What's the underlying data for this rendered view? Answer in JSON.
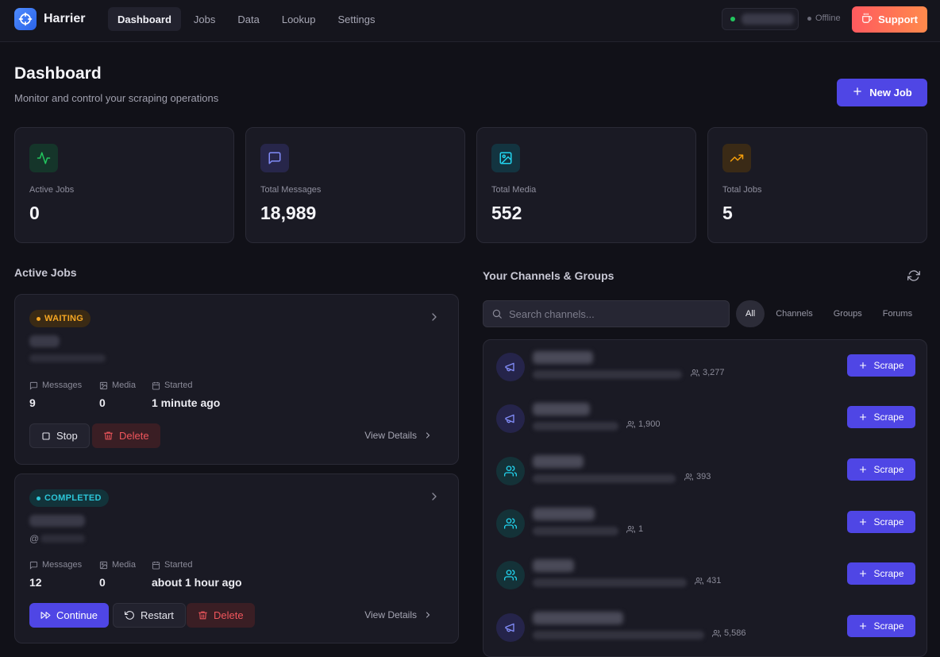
{
  "brand": {
    "name": "Harrier"
  },
  "nav": [
    {
      "label": "Dashboard",
      "active": true
    },
    {
      "label": "Jobs"
    },
    {
      "label": "Data"
    },
    {
      "label": "Lookup"
    },
    {
      "label": "Settings"
    }
  ],
  "status": {
    "connection": "Offline"
  },
  "support": {
    "label": "Support"
  },
  "page": {
    "title": "Dashboard",
    "subtitle": "Monitor and control your scraping operations",
    "new_job_label": "New Job"
  },
  "stats": [
    {
      "label": "Active Jobs",
      "value": "0",
      "icon": "activity-icon",
      "color": "#22c55e"
    },
    {
      "label": "Total Messages",
      "value": "18,989",
      "icon": "message-square-icon",
      "color": "#818cf8"
    },
    {
      "label": "Total Media",
      "value": "552",
      "icon": "image-icon",
      "color": "#22d3ee"
    },
    {
      "label": "Total Jobs",
      "value": "5",
      "icon": "trending-up-icon",
      "color": "#f59e0b"
    }
  ],
  "active_jobs": {
    "title": "Active Jobs",
    "labels": {
      "messages": "Messages",
      "media": "Media",
      "started": "Started",
      "view_details": "View Details"
    },
    "jobs": [
      {
        "status": "WAITING",
        "handle": "",
        "messages": "9",
        "media": "0",
        "started": "1 minute ago",
        "actions": [
          "Stop",
          "Delete"
        ]
      },
      {
        "status": "COMPLETED",
        "handle": "@",
        "messages": "12",
        "media": "0",
        "started": "about 1 hour ago",
        "actions": [
          "Continue",
          "Restart",
          "Delete"
        ]
      }
    ]
  },
  "channels": {
    "title": "Your Channels & Groups",
    "search_placeholder": "Search channels...",
    "filters": [
      "All",
      "Channels",
      "Groups",
      "Forums"
    ],
    "scrape_label": "Scrape",
    "items": [
      {
        "kind": "channel",
        "members": "3,277"
      },
      {
        "kind": "channel",
        "members": "1,900"
      },
      {
        "kind": "group",
        "members": "393"
      },
      {
        "kind": "group",
        "members": "1"
      },
      {
        "kind": "group",
        "members": "431"
      },
      {
        "kind": "channel",
        "members": "5,586"
      }
    ]
  },
  "colors": {
    "accent": "#4f46e5",
    "waiting": "#f5a623",
    "completed": "#2cc6d8",
    "danger": "#f0565c",
    "online": "#22c55e"
  }
}
